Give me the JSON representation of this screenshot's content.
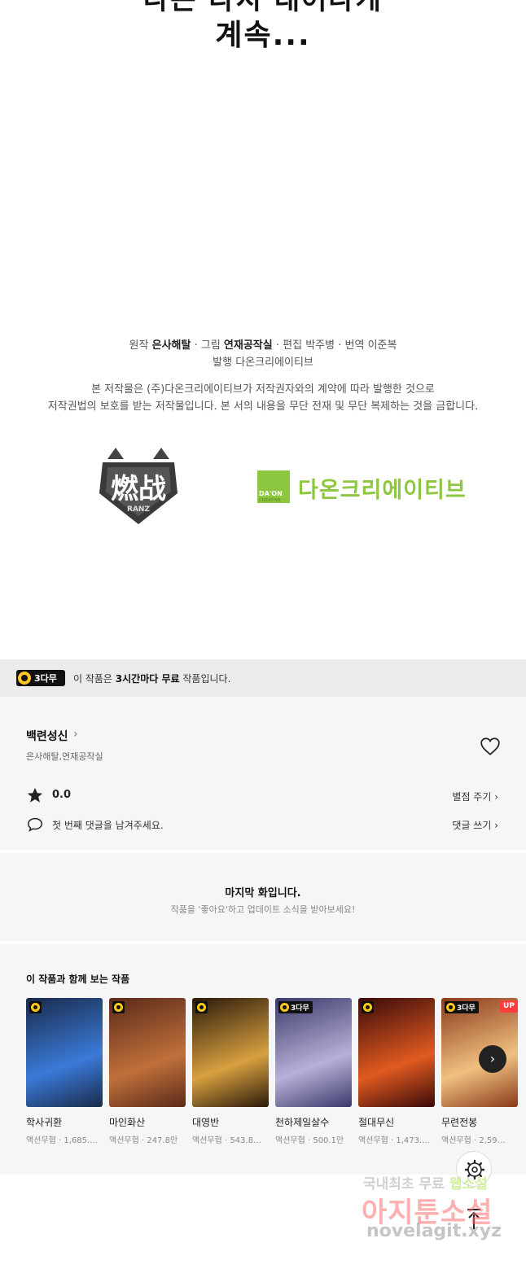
{
  "comic": {
    "text_top": "나는 다시 태어나게",
    "text": "계속..."
  },
  "credits": {
    "original_label": "원작",
    "original": "은사해탈",
    "art_label": "그림",
    "art": "연재공작실",
    "edit_label": "편집",
    "edit": "박주병",
    "translate_label": "번역",
    "translate": "이준복",
    "publisher_label": "발행",
    "publisher": "다온크리에이티브"
  },
  "copyright": {
    "line1": "본 저작물은 (주)다온크리에이티브가 저작권자와의 계약에 따라 발행한 것으로",
    "line2": "저작권법의 보호를 받는 저작물입니다. 본 서의 내용을 무단 전재 및 무단 복제하는 것을 금합니다."
  },
  "logos": {
    "ranzhan_text": "燃战",
    "ranzhan_sub": "RANZ",
    "daon_box": "DA'ON",
    "daon_creative": "CREATIVE",
    "daon_name": "다온크리에이티브"
  },
  "free_banner": {
    "badge": "3다무",
    "text_prefix": "이 작품은 ",
    "text_bold": "3시간마다 무료",
    "text_suffix": " 작품입니다."
  },
  "series": {
    "title": "백련성신",
    "chevron": "›",
    "authors": "은사해탈,연재공작실",
    "rating": "0.0",
    "rate_link": "별점 주기 ›",
    "comment_prompt": "첫 번째 댓글을 남겨주세요.",
    "comment_link": "댓글 쓰기 ›"
  },
  "last_episode": {
    "title": "마지막 화입니다.",
    "subtitle": "작품을 '좋아요'하고 업데이트 소식을 받아보세요!"
  },
  "recommendations": {
    "title": "이 작품과 함께 보는 작품",
    "items": [
      {
        "title": "학사귀환",
        "meta": "액션무협 · 1,685.…",
        "badge": "",
        "up": "",
        "c1": "#1a2a4a",
        "c2": "#3a7ad8"
      },
      {
        "title": "마인화산",
        "meta": "액션무협 · 247.8만",
        "badge": "",
        "up": "",
        "c1": "#5a2a1a",
        "c2": "#c0703a"
      },
      {
        "title": "대영반",
        "meta": "액션무협 · 543.8…",
        "badge": "",
        "up": "",
        "c1": "#2a1a0a",
        "c2": "#d8a040"
      },
      {
        "title": "천하제일살수",
        "meta": "액션무협 · 500.1만",
        "badge": "3다무",
        "up": "",
        "c1": "#3a3a6a",
        "c2": "#b8b0d8"
      },
      {
        "title": "절대무신",
        "meta": "액션무협 · 1,473.…",
        "badge": "",
        "up": "",
        "c1": "#3a0a0a",
        "c2": "#e05a20"
      },
      {
        "title": "무련전봉",
        "meta": "액션무협 · 2,59…",
        "badge": "3다무",
        "up": "UP",
        "c1": "#8a3a1a",
        "c2": "#f0c080"
      }
    ]
  },
  "watermark": {
    "line1a": "국내최초 무료",
    "line1b": "웹소설",
    "line2": "아지툰소설",
    "line3": "novelagit.xyz"
  }
}
